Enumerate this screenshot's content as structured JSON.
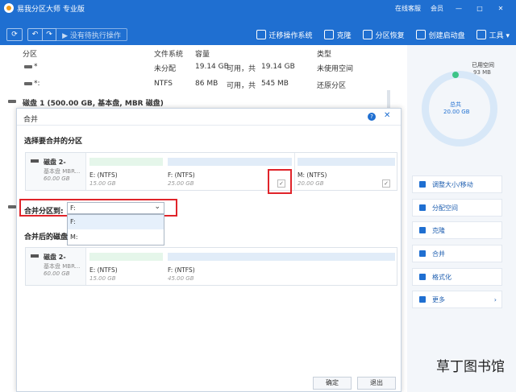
{
  "titlebar": {
    "title": "易我分区大师 专业版",
    "links": [
      "在线客服",
      "会员"
    ],
    "controls": [
      "—",
      "□",
      "✕"
    ]
  },
  "toolbar": {
    "refresh": "⟳",
    "undo": "↶",
    "redo": "↷",
    "pending": "▶ 没有待执行操作",
    "items": [
      "迁移操作系统",
      "克隆",
      "分区恢复",
      "创建启动盘",
      "工具 ▾"
    ]
  },
  "table": {
    "headers": [
      "分区",
      "文件系统",
      "容量",
      "类型"
    ],
    "rows": [
      {
        "name": "*",
        "fs": "未分配",
        "cap": "19.14 GB",
        "avail": "可用，共",
        "total": "19.14 GB",
        "type": "未使用空间"
      },
      {
        "name": "*:",
        "fs": "NTFS",
        "cap": "86 MB",
        "avail": "可用，共",
        "total": "545 MB",
        "type": "还原分区"
      }
    ],
    "disk1": "磁盘 1 (500.00 GB, 基本盘, MBR 磁盘)"
  },
  "right": {
    "used_label": "已用空间",
    "used_value": "93 MB",
    "total_label": "总共",
    "total_value": "20.00 GB",
    "ops": [
      "调整大小/移动",
      "分配空间",
      "克隆",
      "合并",
      "格式化",
      "更多"
    ],
    "more_arrow": "›"
  },
  "dialog": {
    "title": "合并",
    "help": "?",
    "close": "✕",
    "section1": "选择要合并的分区",
    "disk": {
      "name": "磁盘 2-",
      "type": "基本盘 MBR...",
      "size": "60.00 GB"
    },
    "parts1": [
      {
        "name": "E: (NTFS)",
        "size": "15.00 GB",
        "checked": "✓"
      },
      {
        "name": "F: (NTFS)",
        "size": "25.00 GB",
        "checked": "✓"
      },
      {
        "name": "M: (NTFS)",
        "size": "20.00 GB",
        "checked": "✓"
      }
    ],
    "merge_to_label": "合并分区到:",
    "merge_to_value": "F:",
    "merge_to_arrow": "⌄",
    "options": [
      "F:",
      "M:"
    ],
    "section2": "合并后的磁盘",
    "parts2": [
      {
        "name": "E: (NTFS)",
        "size": "15.00 GB"
      },
      {
        "name": "F: (NTFS)",
        "size": "45.00 GB"
      }
    ],
    "ok": "确定",
    "cancel": "退出"
  },
  "watermark": "草丁图书馆",
  "colors": {
    "brand": "#1f6fd1",
    "highlight": "#e0242a",
    "used": "#3cc487"
  }
}
